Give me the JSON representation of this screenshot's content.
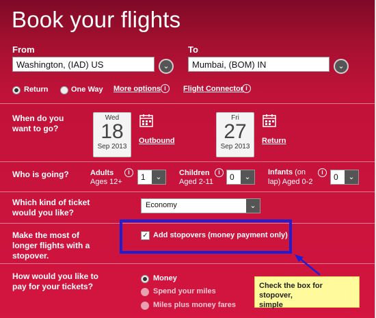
{
  "title": "Book your flights",
  "from": {
    "label": "From",
    "value": "Washington, (IAD) US"
  },
  "to": {
    "label": "To",
    "value": "Mumbai, (BOM) IN"
  },
  "trip": {
    "return_label": "Return",
    "oneway_label": "One Way",
    "more_options": "More options",
    "flight_connector": "Flight Connector"
  },
  "when": {
    "label_line1": "When do you",
    "label_line2": "want to go?",
    "outbound": {
      "day": "Wed",
      "date": "18",
      "month": "Sep 2013",
      "link": "Outbound"
    },
    "return": {
      "day": "Fri",
      "date": "27",
      "month": "Sep 2013",
      "link": "Return"
    }
  },
  "who": {
    "label": "Who is going?",
    "adults": {
      "label": "Adults",
      "sub": "Ages 12+",
      "value": "1"
    },
    "children": {
      "label": "Children",
      "sub": "Aged 2-11",
      "value": "0"
    },
    "infants": {
      "label": "Infants",
      "label_suffix": " (on",
      "sub": "lap) Aged 0-2",
      "value": "0"
    }
  },
  "ticket": {
    "label_line1": "Which kind of ticket",
    "label_line2": "would you like?",
    "value": "Economy"
  },
  "stopover": {
    "label_line1": "Make the most of",
    "label_line2": "longer flights with a",
    "label_line3": "stopover.",
    "checkbox_label": "Add stopovers (money payment only)",
    "checked": true
  },
  "pay": {
    "label_line1": "How would you like to",
    "label_line2": "pay for your tickets?",
    "options": [
      "Money",
      "Spend your miles",
      "Miles plus money fares"
    ]
  },
  "annotation": {
    "line1": "Check the box for stopover,",
    "line2": "simple",
    "highlight_color": "#1b1fd6",
    "note_color": "#fffa9c"
  },
  "colors": {
    "panel_top": "#7d0a27",
    "panel_bottom": "#d3153f"
  }
}
